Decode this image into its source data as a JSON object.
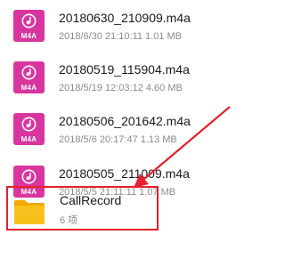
{
  "files": [
    {
      "name": "20180630_210909.m4a",
      "meta": "2018/6/30 21:10:11 1.01 MB",
      "icon": "m4a-file-icon",
      "icon_label": "M4A"
    },
    {
      "name": "20180519_115904.m4a",
      "meta": "2018/5/19 12:03:12 4.60 MB",
      "icon": "m4a-file-icon",
      "icon_label": "M4A"
    },
    {
      "name": "20180506_201642.m4a",
      "meta": "2018/5/6 20:17:47 1.13 MB",
      "icon": "m4a-file-icon",
      "icon_label": "M4A"
    },
    {
      "name": "20180505_211009.m4a",
      "meta": "2018/5/5 21:11:11 1.07 MB",
      "icon": "m4a-file-icon",
      "icon_label": "M4A"
    }
  ],
  "folder": {
    "name": "CallRecord",
    "meta": "6 项",
    "icon": "folder-icon"
  },
  "colors": {
    "m4a_icon": "#d9359f",
    "folder": "#f5b800",
    "highlight": "#e4212a"
  }
}
